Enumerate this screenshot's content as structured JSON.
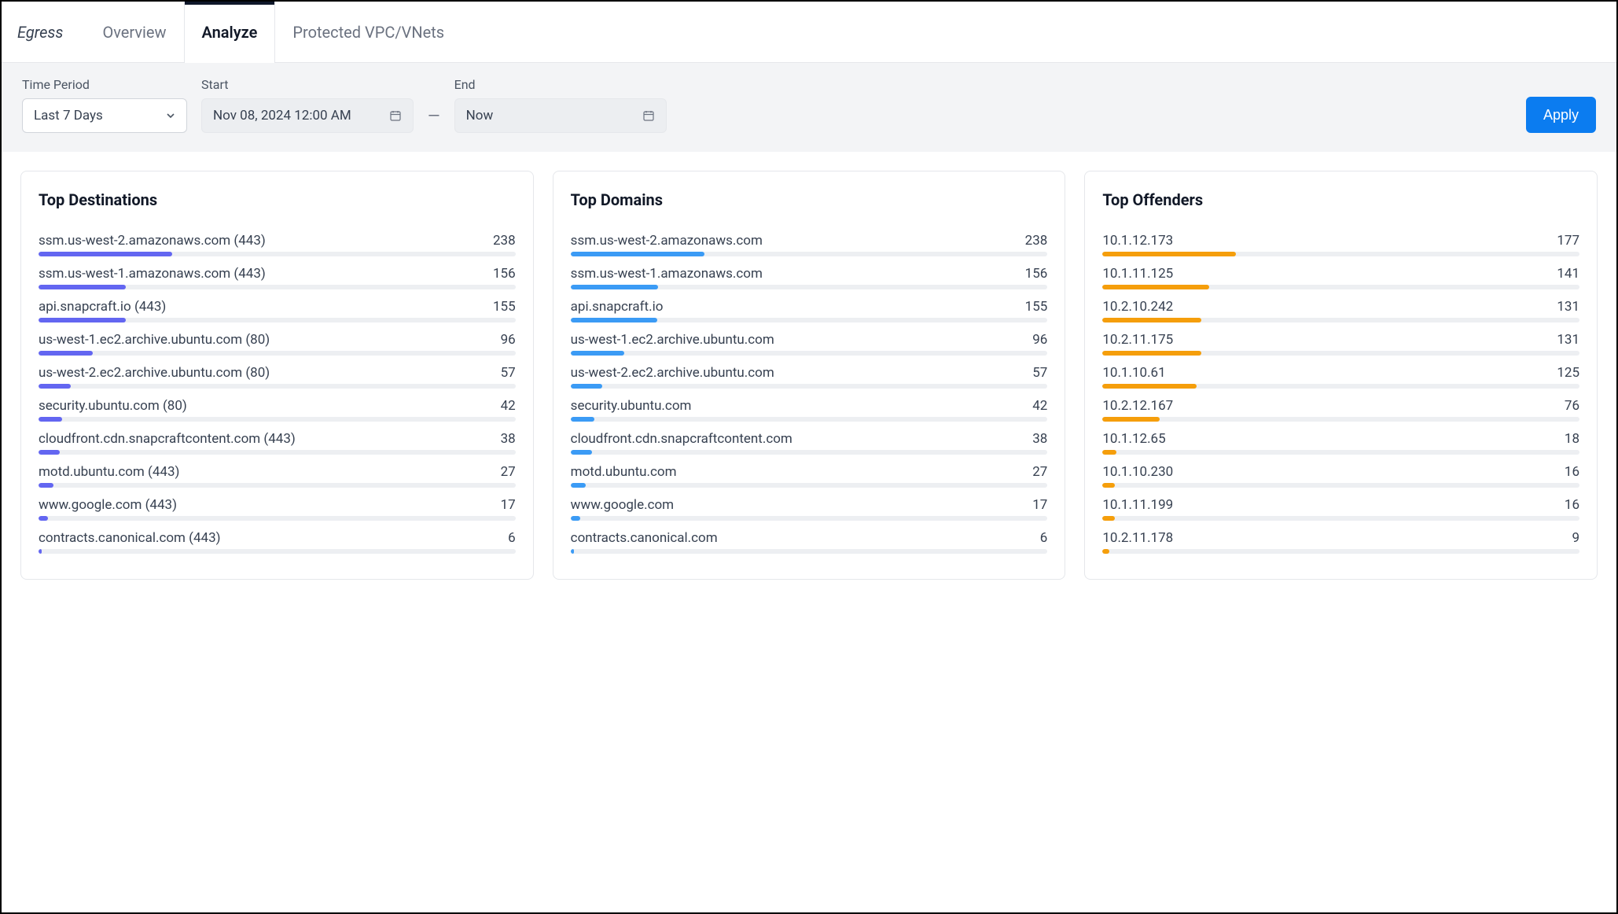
{
  "header": {
    "page_label": "Egress",
    "tabs": [
      {
        "label": "Overview",
        "active": false
      },
      {
        "label": "Analyze",
        "active": true
      },
      {
        "label": "Protected VPC/VNets",
        "active": false
      }
    ]
  },
  "filters": {
    "time_period": {
      "label": "Time Period",
      "value": "Last 7 Days"
    },
    "start": {
      "label": "Start",
      "value": "Nov 08, 2024 12:00 AM"
    },
    "end": {
      "label": "End",
      "value": "Now"
    },
    "apply_label": "Apply"
  },
  "cards": {
    "destinations": {
      "title": "Top Destinations",
      "color": "purple",
      "items": [
        {
          "label": "ssm.us-west-2.amazonaws.com (443)",
          "value": 238
        },
        {
          "label": "ssm.us-west-1.amazonaws.com (443)",
          "value": 156
        },
        {
          "label": "api.snapcraft.io (443)",
          "value": 155
        },
        {
          "label": "us-west-1.ec2.archive.ubuntu.com (80)",
          "value": 96
        },
        {
          "label": "us-west-2.ec2.archive.ubuntu.com (80)",
          "value": 57
        },
        {
          "label": "security.ubuntu.com (80)",
          "value": 42
        },
        {
          "label": "cloudfront.cdn.snapcraftcontent.com (443)",
          "value": 38
        },
        {
          "label": "motd.ubuntu.com (443)",
          "value": 27
        },
        {
          "label": "www.google.com (443)",
          "value": 17
        },
        {
          "label": "contracts.canonical.com (443)",
          "value": 6
        }
      ]
    },
    "domains": {
      "title": "Top Domains",
      "color": "blue",
      "items": [
        {
          "label": "ssm.us-west-2.amazonaws.com",
          "value": 238
        },
        {
          "label": "ssm.us-west-1.amazonaws.com",
          "value": 156
        },
        {
          "label": "api.snapcraft.io",
          "value": 155
        },
        {
          "label": "us-west-1.ec2.archive.ubuntu.com",
          "value": 96
        },
        {
          "label": "us-west-2.ec2.archive.ubuntu.com",
          "value": 57
        },
        {
          "label": "security.ubuntu.com",
          "value": 42
        },
        {
          "label": "cloudfront.cdn.snapcraftcontent.com",
          "value": 38
        },
        {
          "label": "motd.ubuntu.com",
          "value": 27
        },
        {
          "label": "www.google.com",
          "value": 17
        },
        {
          "label": "contracts.canonical.com",
          "value": 6
        }
      ]
    },
    "offenders": {
      "title": "Top Offenders",
      "color": "orange",
      "items": [
        {
          "label": "10.1.12.173",
          "value": 177
        },
        {
          "label": "10.1.11.125",
          "value": 141
        },
        {
          "label": "10.2.10.242",
          "value": 131
        },
        {
          "label": "10.2.11.175",
          "value": 131
        },
        {
          "label": "10.1.10.61",
          "value": 125
        },
        {
          "label": "10.2.12.167",
          "value": 76
        },
        {
          "label": "10.1.12.65",
          "value": 18
        },
        {
          "label": "10.1.10.230",
          "value": 16
        },
        {
          "label": "10.1.11.199",
          "value": 16
        },
        {
          "label": "10.2.11.178",
          "value": 9
        }
      ]
    }
  },
  "chart_data": [
    {
      "type": "bar",
      "title": "Top Destinations",
      "categories": [
        "ssm.us-west-2.amazonaws.com (443)",
        "ssm.us-west-1.amazonaws.com (443)",
        "api.snapcraft.io (443)",
        "us-west-1.ec2.archive.ubuntu.com (80)",
        "us-west-2.ec2.archive.ubuntu.com (80)",
        "security.ubuntu.com (80)",
        "cloudfront.cdn.snapcraftcontent.com (443)",
        "motd.ubuntu.com (443)",
        "www.google.com (443)",
        "contracts.canonical.com (443)"
      ],
      "values": [
        238,
        156,
        155,
        96,
        57,
        42,
        38,
        27,
        17,
        6
      ],
      "xlabel": "",
      "ylabel": "",
      "xlim": [
        0,
        850
      ]
    },
    {
      "type": "bar",
      "title": "Top Domains",
      "categories": [
        "ssm.us-west-2.amazonaws.com",
        "ssm.us-west-1.amazonaws.com",
        "api.snapcraft.io",
        "us-west-1.ec2.archive.ubuntu.com",
        "us-west-2.ec2.archive.ubuntu.com",
        "security.ubuntu.com",
        "cloudfront.cdn.snapcraftcontent.com",
        "motd.ubuntu.com",
        "www.google.com",
        "contracts.canonical.com"
      ],
      "values": [
        238,
        156,
        155,
        96,
        57,
        42,
        38,
        27,
        17,
        6
      ],
      "xlabel": "",
      "ylabel": "",
      "xlim": [
        0,
        850
      ]
    },
    {
      "type": "bar",
      "title": "Top Offenders",
      "categories": [
        "10.1.12.173",
        "10.1.11.125",
        "10.2.10.242",
        "10.2.11.175",
        "10.1.10.61",
        "10.2.12.167",
        "10.1.12.65",
        "10.1.10.230",
        "10.1.11.199",
        "10.2.11.178"
      ],
      "values": [
        177,
        141,
        131,
        131,
        125,
        76,
        18,
        16,
        16,
        9
      ],
      "xlabel": "",
      "ylabel": "",
      "xlim": [
        0,
        850
      ]
    }
  ]
}
